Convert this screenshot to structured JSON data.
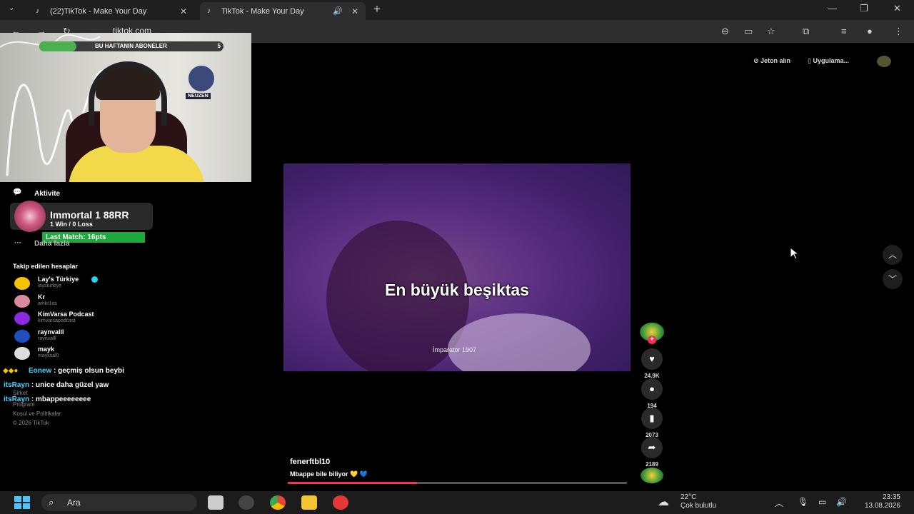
{
  "browser": {
    "tabs": [
      {
        "title": "(22)TikTok - Make Your Day"
      },
      {
        "title": "TikTok - Make Your Day"
      }
    ],
    "url": "tiktok.com"
  },
  "overlay": {
    "subscriber_goal_label": "BU HAFTANIN ABONELER",
    "subscriber_goal_count": "5",
    "subscriber_goal_progress": 0.2,
    "channel_logo_text": "NEUZEN",
    "rank_title": "Immortal 1  88RR",
    "rank_record": "1 Win / 0 Loss",
    "last_match": "Last Match: 16pts"
  },
  "sidebar": {
    "activity_label": "Aktivite",
    "more_label": "Daha fazla",
    "following_heading": "Takip edilen hesaplar",
    "accounts": [
      {
        "name": "Lay's Türkiye",
        "handle": "laysturkiye",
        "verified": true,
        "color": "#f5c400"
      },
      {
        "name": "Kr",
        "handle": "amkr1es",
        "verified": false,
        "color": "#d98aa0"
      },
      {
        "name": "KimVarsa Podcast",
        "handle": "kimvarsapodcast",
        "verified": false,
        "color": "#8a2be2"
      },
      {
        "name": "raynvalll",
        "handle": "raynvalll",
        "verified": false,
        "color": "#1e4fbf"
      },
      {
        "name": "mayk",
        "handle": "mayksal0",
        "verified": false,
        "color": "#ddd"
      }
    ],
    "footer": {
      "company": "Şirket",
      "program": "Program",
      "terms": "Koşul ve Politikalar",
      "copyright": "© 2026 TikTok"
    }
  },
  "chat": [
    {
      "user": "Eonew",
      "message": " : geçmiş olsun beybi"
    },
    {
      "user": "itsRayn",
      "message": " : unice daha güzel yaw"
    },
    {
      "user": "itsRayn",
      "message": " : mbappeeeeeeee"
    }
  ],
  "video": {
    "caption": "En büyük beşiktas",
    "watermark": "İmparator 1907",
    "author": "fenerftbl10",
    "description": "Mbappe bile biliyor 💛 💙",
    "progress": 0.38,
    "likes": "24.9K",
    "comments": "194",
    "saves": "2073",
    "shares": "2189"
  },
  "header_actions": {
    "coins": "Jeton alın",
    "app": "Uygulama..."
  },
  "taskbar": {
    "search_placeholder": "Ara",
    "weather_temp": "22°C",
    "weather_desc": "Çok bulutlu",
    "time": "23:35",
    "date": "13.08.2026"
  },
  "colors": {
    "tiktok_red": "#fe2c55",
    "chat_user": "#3fd8ff",
    "last_match_green": "#1fa83b"
  }
}
